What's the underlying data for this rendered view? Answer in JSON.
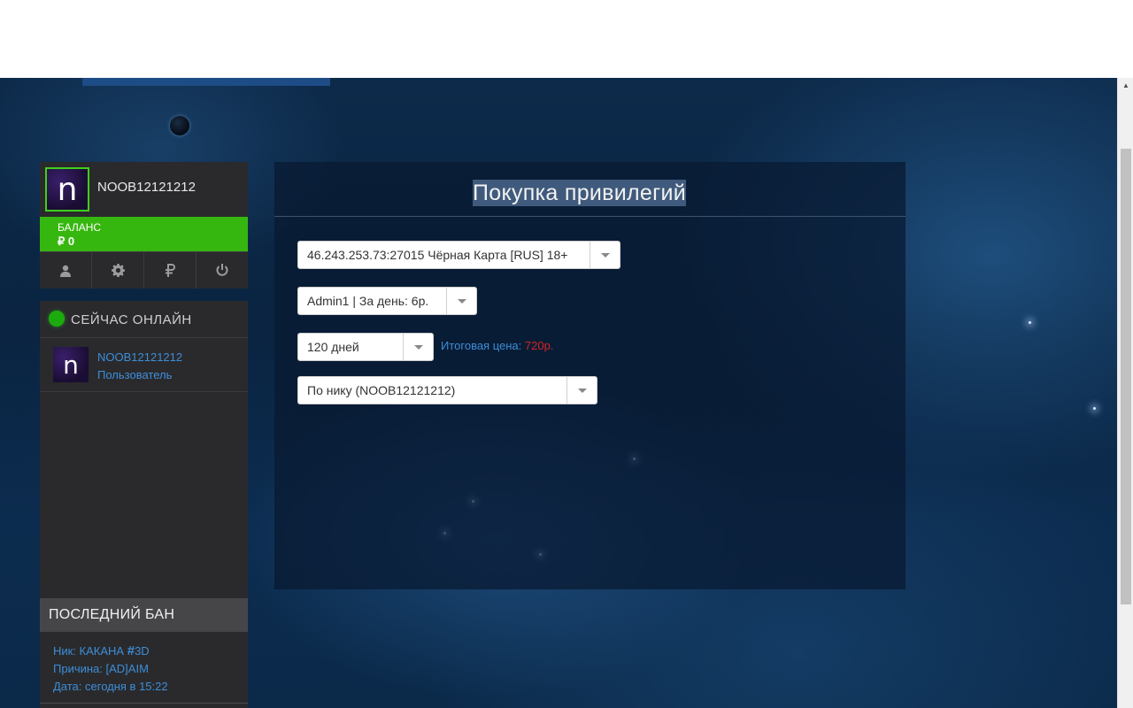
{
  "profile": {
    "avatar_letter": "n",
    "username": "NOOB12121212",
    "balance_label": "БАЛАНС",
    "balance_value": "₽ 0",
    "icons": [
      "user-icon",
      "gear-icon",
      "ruble-icon",
      "power-icon"
    ]
  },
  "online": {
    "title": "СЕЙЧАС ОНЛАЙН",
    "user_name": "NOOB12121212",
    "user_role": "Пользователь",
    "avatar_letter": "n"
  },
  "last_ban": {
    "title": "ПОСЛЕДНИЙ БАН",
    "nick_label": "Ник: КАКАНА ",
    "nick_hash": "#",
    "nick_suffix": "3D",
    "reason": "Причина: [AD]AIM",
    "date": "Дата: сегодня в 15:22"
  },
  "purchase": {
    "title": "Покупка привилегий",
    "server_select": "46.243.253.73:27015 Чёрная Карта [RUS] 18+",
    "privilege_select": "Admin1 | За день: 6р.",
    "duration_select": "120 дней",
    "total_label": "Итоговая цена: ",
    "total_value": "720р.",
    "auth_select": "По нику (NOOB12121212)"
  },
  "colors": {
    "accent_green": "#36b70f",
    "link_blue": "#3d8ed8",
    "price_red": "#d62525",
    "panel_dark": "#2a2a2d"
  }
}
